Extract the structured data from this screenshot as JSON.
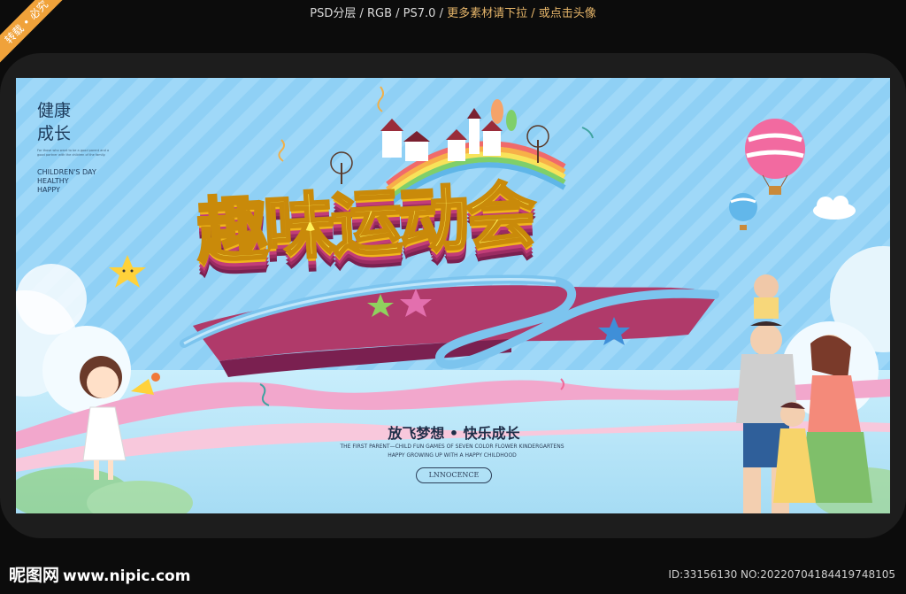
{
  "watermark_bar": {
    "part1": "PSD分层 / RGB / PS7.0 /",
    "part2": "更多素材请下拉 / 或点击头像"
  },
  "corner_ribbon": "转载 • 必究",
  "poster": {
    "side_title_line1": "健康",
    "side_title_line2": "成长",
    "side_small_text": "For those who want to be a good parent and a good partner with the children of the family.",
    "side_en_line1": "CHILDREN'S DAY",
    "side_en_line2": "HEALTHY",
    "side_en_line3": "HAPPY",
    "main_title": "趣味运动会",
    "slogan": "放飞梦想 • 快乐成长",
    "english_line1": "THE FIRST PARENT—CHILD FUN GAMES OF SEVEN COLOR FLOWER KINDERGARTENS",
    "english_line2": "HAPPY GROWING UP WITH A HAPPY CHILDHOOD",
    "tag_label": "LNNOCENCE"
  },
  "footer": {
    "logo_text": "昵图网",
    "logo_url": "www.nipic.com",
    "id_text": "ID:33156130 NO:20220704184419748105"
  },
  "colors": {
    "sky": "#8fd0f5",
    "title_yellow": "#fff25a",
    "title_edge": "#c23d78",
    "ribbon_orange": "#f0a23a"
  }
}
